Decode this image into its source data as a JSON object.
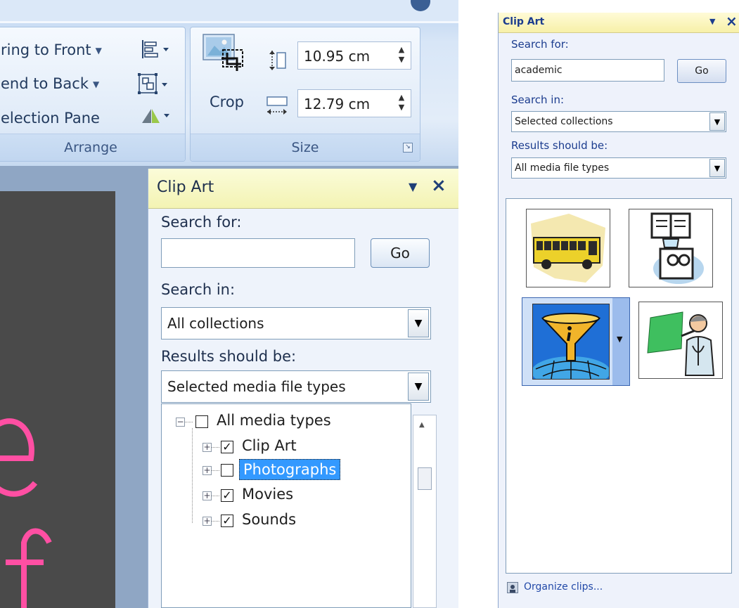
{
  "ribbon": {
    "arrange": {
      "bring_to_front": "ring to Front",
      "send_to_back": "end to Back",
      "selection_pane": "election Pane",
      "group_label": "Arrange"
    },
    "size": {
      "crop_label": "Crop",
      "height_value": "10.95 cm",
      "width_value": "12.79 cm",
      "group_label": "Size"
    }
  },
  "pane_large": {
    "title": "Clip Art",
    "search_for_label": "Search for:",
    "search_value": "",
    "go_label": "Go",
    "search_in_label": "Search in:",
    "search_in_value": "All collections",
    "results_label": "Results should be:",
    "results_value": "Selected media file types",
    "tree": {
      "root": {
        "label": "All media types",
        "checked": false
      },
      "children": [
        {
          "label": "Clip Art",
          "checked": true,
          "mark": "☑"
        },
        {
          "label": "Photographs",
          "checked": false,
          "selected": true
        },
        {
          "label": "Movies",
          "checked": true
        },
        {
          "label": "Sounds",
          "checked": true
        }
      ]
    }
  },
  "pane_small": {
    "title": "Clip Art",
    "search_for_label": "Search for:",
    "search_value": "academic",
    "go_label": "Go",
    "search_in_label": "Search in:",
    "search_in_value": "Selected collections",
    "results_label": "Results should be:",
    "results_value": "All media file types",
    "results": [
      {
        "icon": "school-bus-icon"
      },
      {
        "icon": "book-projector-icon"
      },
      {
        "icon": "information-funnel-icon",
        "selected": true
      },
      {
        "icon": "teacher-board-icon"
      }
    ],
    "organize_label": "Organize clips..."
  },
  "colors": {
    "pane_title_bg": "#f3f3b3",
    "selection_bg": "#3399ff",
    "slide_text": "#ff4fa3"
  }
}
